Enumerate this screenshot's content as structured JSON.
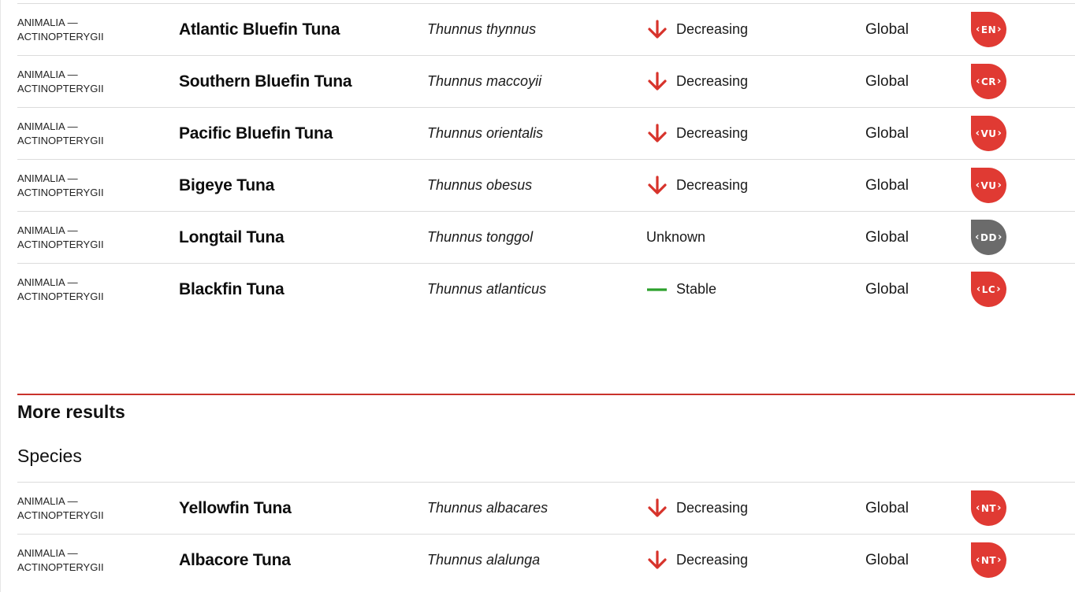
{
  "results_top": [
    {
      "kingdom": "ANIMALIA —",
      "class": "ACTINOPTERYGII",
      "common_name": "Atlantic Bluefin Tuna",
      "scientific_name": "Thunnus thynnus",
      "trend": "Decreasing",
      "trend_icon": "arrow-down-icon",
      "scope": "Global",
      "category": "EN",
      "badge_color": "#e03a33"
    },
    {
      "kingdom": "ANIMALIA —",
      "class": "ACTINOPTERYGII",
      "common_name": "Southern Bluefin Tuna",
      "scientific_name": "Thunnus maccoyii",
      "trend": "Decreasing",
      "trend_icon": "arrow-down-icon",
      "scope": "Global",
      "category": "CR",
      "badge_color": "#e03a33"
    },
    {
      "kingdom": "ANIMALIA —",
      "class": "ACTINOPTERYGII",
      "common_name": "Pacific Bluefin Tuna",
      "scientific_name": "Thunnus orientalis",
      "trend": "Decreasing",
      "trend_icon": "arrow-down-icon",
      "scope": "Global",
      "category": "VU",
      "badge_color": "#e03a33"
    },
    {
      "kingdom": "ANIMALIA —",
      "class": "ACTINOPTERYGII",
      "common_name": "Bigeye Tuna",
      "scientific_name": "Thunnus obesus",
      "trend": "Decreasing",
      "trend_icon": "arrow-down-icon",
      "scope": "Global",
      "category": "VU",
      "badge_color": "#e03a33"
    },
    {
      "kingdom": "ANIMALIA —",
      "class": "ACTINOPTERYGII",
      "common_name": "Longtail Tuna",
      "scientific_name": "Thunnus tonggol",
      "trend": "Unknown",
      "trend_icon": "",
      "scope": "Global",
      "category": "DD",
      "badge_color": "#6b6b6b"
    },
    {
      "kingdom": "ANIMALIA —",
      "class": "ACTINOPTERYGII",
      "common_name": "Blackfin Tuna",
      "scientific_name": "Thunnus atlanticus",
      "trend": "Stable",
      "trend_icon": "stable-dash-icon",
      "scope": "Global",
      "category": "LC",
      "badge_color": "#e03a33"
    }
  ],
  "more_results": {
    "heading": "More results",
    "species_heading": "Species"
  },
  "results_bottom": [
    {
      "kingdom": "ANIMALIA —",
      "class": "ACTINOPTERYGII",
      "common_name": "Yellowfin Tuna",
      "scientific_name": "Thunnus albacares",
      "trend": "Decreasing",
      "trend_icon": "arrow-down-icon",
      "scope": "Global",
      "category": "NT",
      "badge_color": "#e03a33"
    },
    {
      "kingdom": "ANIMALIA —",
      "class": "ACTINOPTERYGII",
      "common_name": "Albacore Tuna",
      "scientific_name": "Thunnus alalunga",
      "trend": "Decreasing",
      "trend_icon": "arrow-down-icon",
      "scope": "Global",
      "category": "NT",
      "badge_color": "#e03a33"
    }
  ],
  "colors": {
    "decreasing_arrow": "#d7332b",
    "stable_dash": "#2ca02c",
    "divider": "#c9322b"
  }
}
